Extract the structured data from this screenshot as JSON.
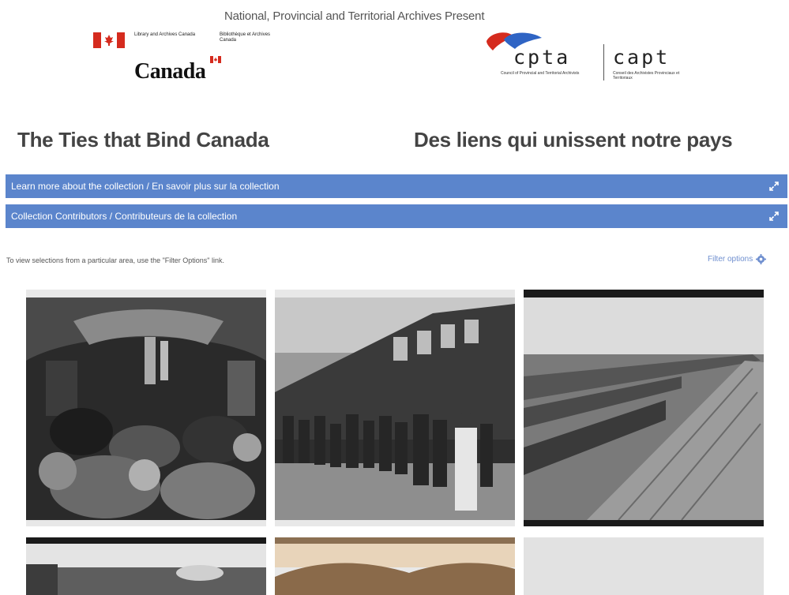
{
  "header": {
    "present_text": "National, Provincial and Territorial Archives Present",
    "lac": {
      "english_name": "Library and Archives Canada",
      "french_name": "Bibliothèque et Archives Canada",
      "wordmark": "Canada"
    },
    "cpta": {
      "acronym_en": "cpta",
      "acronym_fr": "capt",
      "subtitle_en": "Council of Provincial and Territorial Archivists",
      "subtitle_fr": "Conseil des Archivistes Provinciaux et Territoriaux"
    }
  },
  "titles": {
    "english": "The Ties that Bind Canada",
    "french": "Des liens qui unissent notre pays"
  },
  "accordions": [
    {
      "label": "Learn more about the collection / En savoir plus sur la collection",
      "icon": "expand-icon"
    },
    {
      "label": "Collection Contributors / Contributeurs de la collection",
      "icon": "expand-icon"
    }
  ],
  "filter": {
    "note": "To view selections from a particular area, use the \"Filter Options\" link.",
    "link_label": "Filter options",
    "icon": "gear-icon"
  },
  "gallery": {
    "items": [
      {
        "subject": "railway-car-interior-photo"
      },
      {
        "subject": "group-beside-passenger-train-photo"
      },
      {
        "subject": "train-car-rooftops-photo"
      },
      {
        "subject": "landscape-photo"
      },
      {
        "subject": "sepia-hills-photo"
      },
      {
        "subject": "blank-photo"
      }
    ]
  },
  "colors": {
    "accordion_bg": "#5b85cc",
    "link": "#6f8fcf",
    "flag_red": "#d52b1e"
  }
}
